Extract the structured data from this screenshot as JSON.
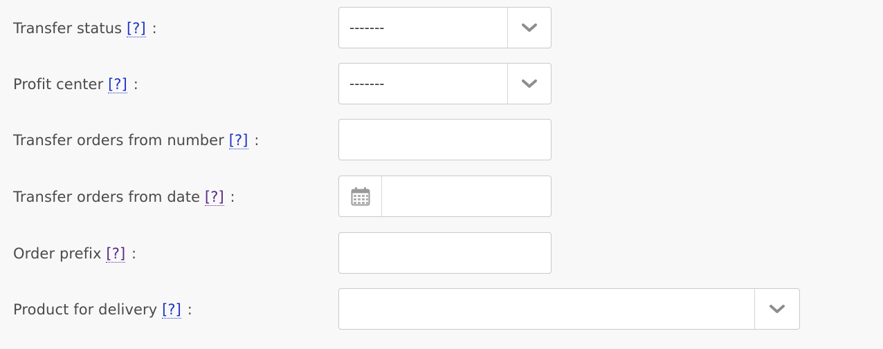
{
  "form": {
    "fields": [
      {
        "label": "Transfer status",
        "help": "[?]",
        "colon": ":",
        "type": "select",
        "value": "-------"
      },
      {
        "label": "Profit center",
        "help": "[?]",
        "colon": ":",
        "type": "select",
        "value": "-------"
      },
      {
        "label": "Transfer orders from number",
        "help": "[?]",
        "colon": ":",
        "type": "text",
        "value": ""
      },
      {
        "label": "Transfer orders from date",
        "help": "[?]",
        "colon": ":",
        "type": "date",
        "value": "",
        "icon": "calendar-icon"
      },
      {
        "label": "Order prefix",
        "help": "[?]",
        "colon": ":",
        "type": "text",
        "value": ""
      },
      {
        "label": "Product for delivery",
        "help": "[?]",
        "colon": ":",
        "type": "select",
        "value": ""
      }
    ]
  },
  "colors": {
    "background": "#f8f8f8",
    "help_link_unvisited": "#1f34c8",
    "help_link_visited": "#5b2a86",
    "border": "#c9c9c9",
    "caret": "#8e8e8e"
  },
  "icons": {
    "dropdown": "chevron-down-icon",
    "date": "calendar-icon"
  }
}
